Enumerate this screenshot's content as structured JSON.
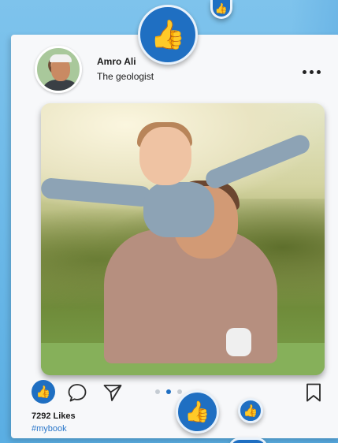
{
  "profile": {
    "name": "Amro Ali",
    "subtitle": "The geologist"
  },
  "post": {
    "likes_text": "7292 Likes",
    "hashtag": "#mybook",
    "carousel": {
      "count": 3,
      "active_index": 1
    }
  },
  "icons": {
    "like": "thumbs-up-icon",
    "comment": "speech-bubble-icon",
    "share": "paper-plane-icon",
    "save": "bookmark-icon",
    "more": "more-horizontal-icon",
    "floating_like": "thumbs-up-icon"
  },
  "colors": {
    "accent": "#1f6fc2",
    "background": "#6fb8e8",
    "card": "#f7f8fa",
    "hashtag": "#2a76c9"
  }
}
